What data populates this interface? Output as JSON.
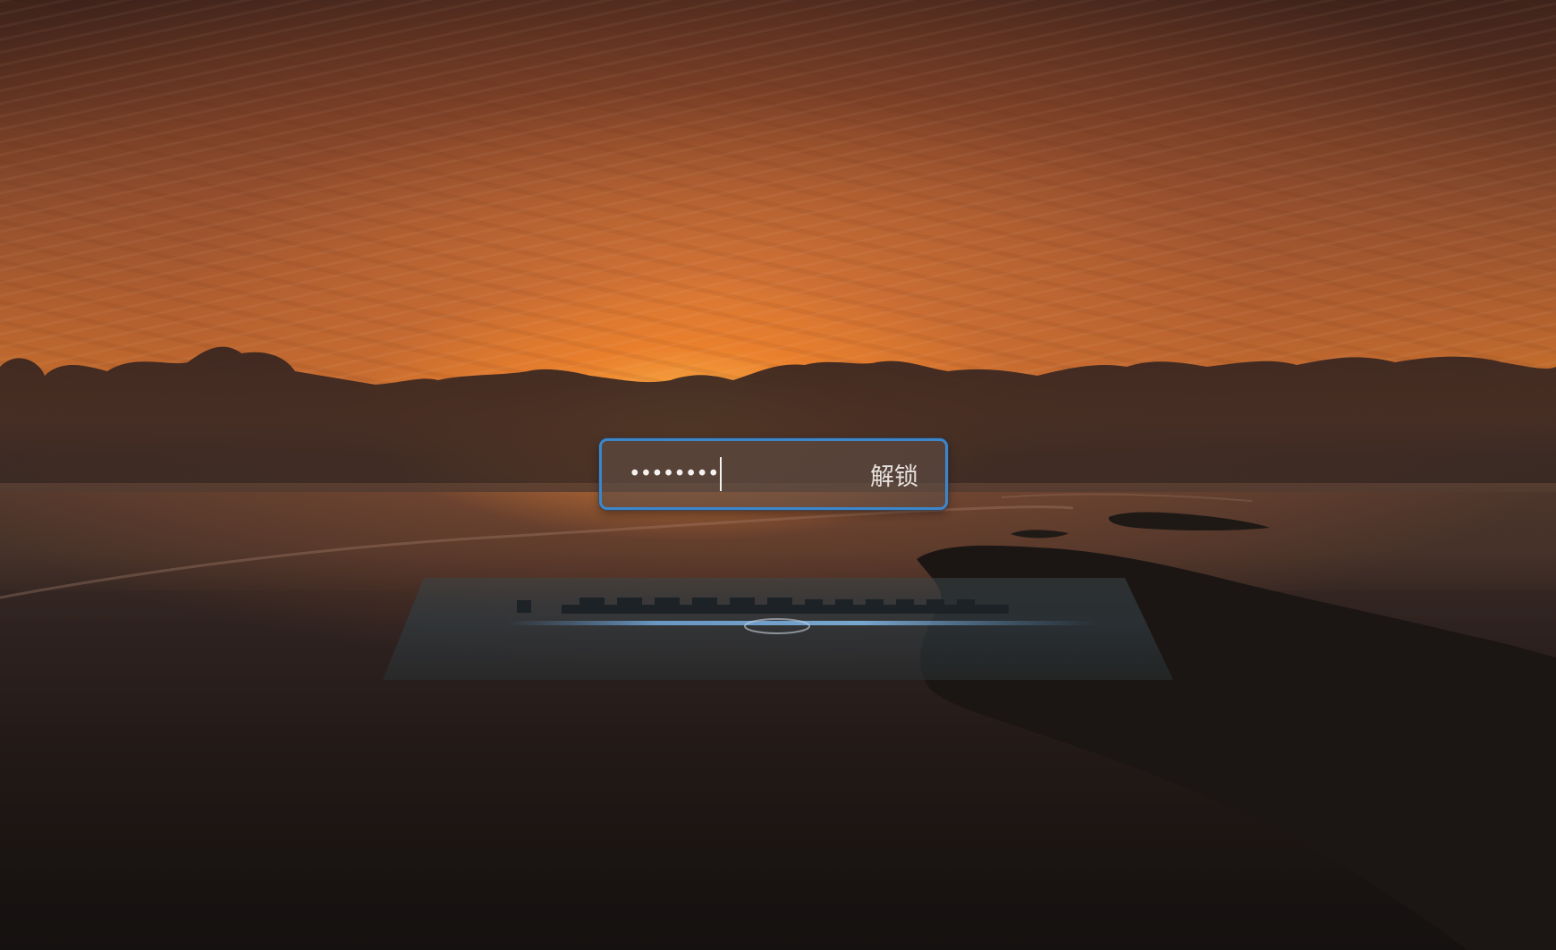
{
  "lock_screen": {
    "password_field": {
      "masked_value": "••••••••",
      "character_count": 8,
      "focused": true
    },
    "unlock_button": {
      "label": "解锁"
    },
    "accent_color": "#3c86c9",
    "wallpaper": {
      "scene": "sunset-over-ocean-with-islands"
    }
  }
}
